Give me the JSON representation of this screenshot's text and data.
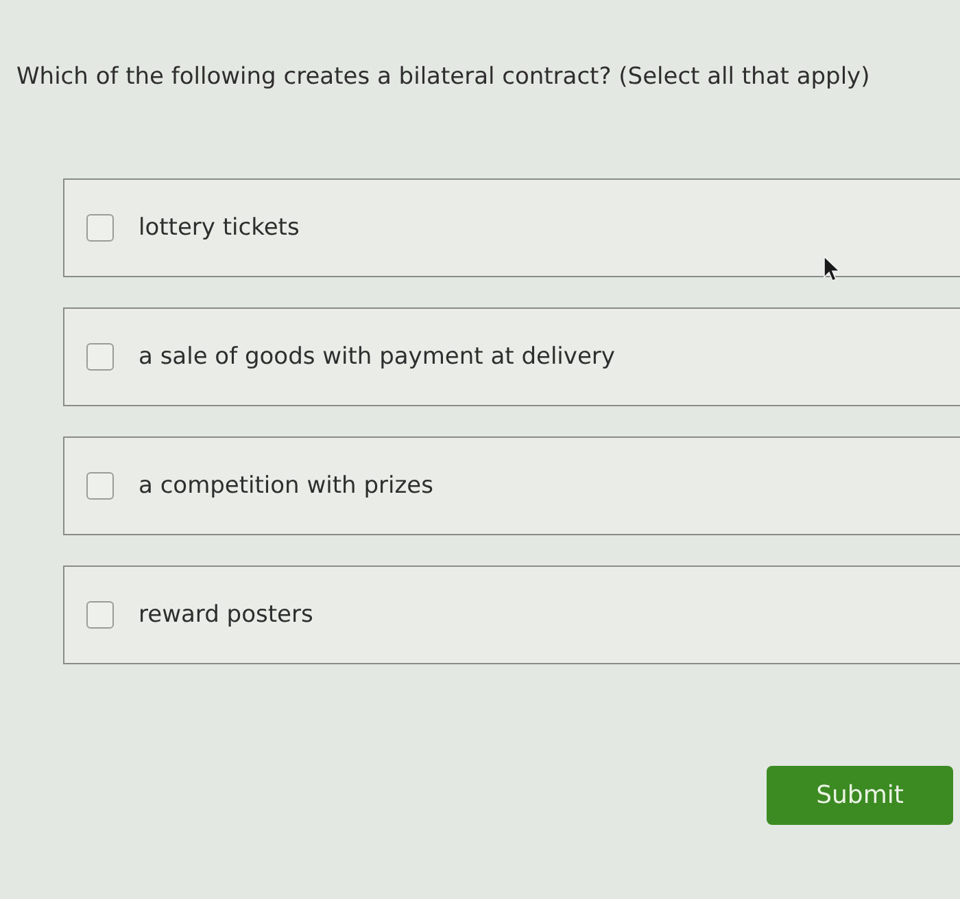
{
  "question": "Which of the following creates a bilateral contract? (Select all that apply)",
  "options": [
    {
      "label": "lottery tickets",
      "checked": false
    },
    {
      "label": "a sale of goods with payment at delivery",
      "checked": false
    },
    {
      "label": "a competition with prizes",
      "checked": false
    },
    {
      "label": "reward posters",
      "checked": false
    }
  ],
  "submit": {
    "label": "Submit"
  }
}
